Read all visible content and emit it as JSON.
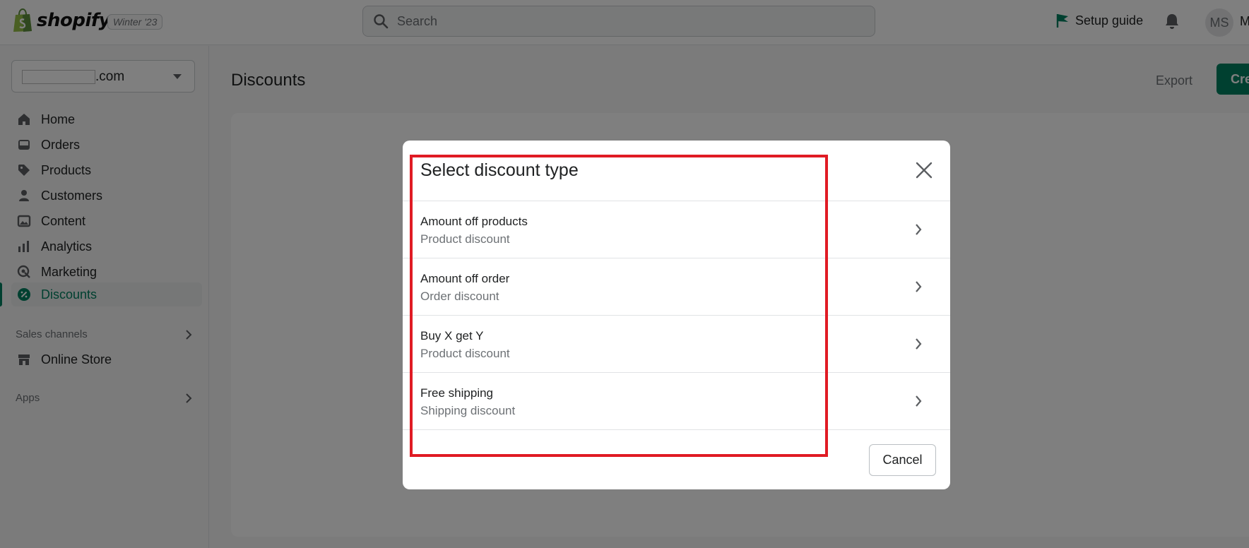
{
  "topbar": {
    "brand": "shopify",
    "edition": "Winter '23",
    "search_placeholder": "Search",
    "setup_guide": "Setup guide",
    "avatar_initials": "MS",
    "user_name_partial": "M"
  },
  "sidebar": {
    "store_suffix": ".com",
    "items": [
      {
        "label": "Home",
        "icon": "home-icon"
      },
      {
        "label": "Orders",
        "icon": "orders-icon"
      },
      {
        "label": "Products",
        "icon": "tag-icon"
      },
      {
        "label": "Customers",
        "icon": "person-icon"
      },
      {
        "label": "Content",
        "icon": "image-icon"
      },
      {
        "label": "Analytics",
        "icon": "bar-chart-icon"
      },
      {
        "label": "Marketing",
        "icon": "target-icon"
      },
      {
        "label": "Discounts",
        "icon": "discount-icon",
        "active": true
      }
    ],
    "sales_channels": "Sales channels",
    "online_store": "Online Store",
    "apps": "Apps"
  },
  "main": {
    "title": "Discounts",
    "export": "Export",
    "create_partial": "Cre"
  },
  "modal": {
    "title": "Select discount type",
    "options": [
      {
        "title": "Amount off products",
        "subtitle": "Product discount"
      },
      {
        "title": "Amount off order",
        "subtitle": "Order discount"
      },
      {
        "title": "Buy X get Y",
        "subtitle": "Product discount"
      },
      {
        "title": "Free shipping",
        "subtitle": "Shipping discount"
      }
    ],
    "cancel": "Cancel"
  },
  "colors": {
    "accent": "#008060",
    "highlight": "#e01b24"
  }
}
